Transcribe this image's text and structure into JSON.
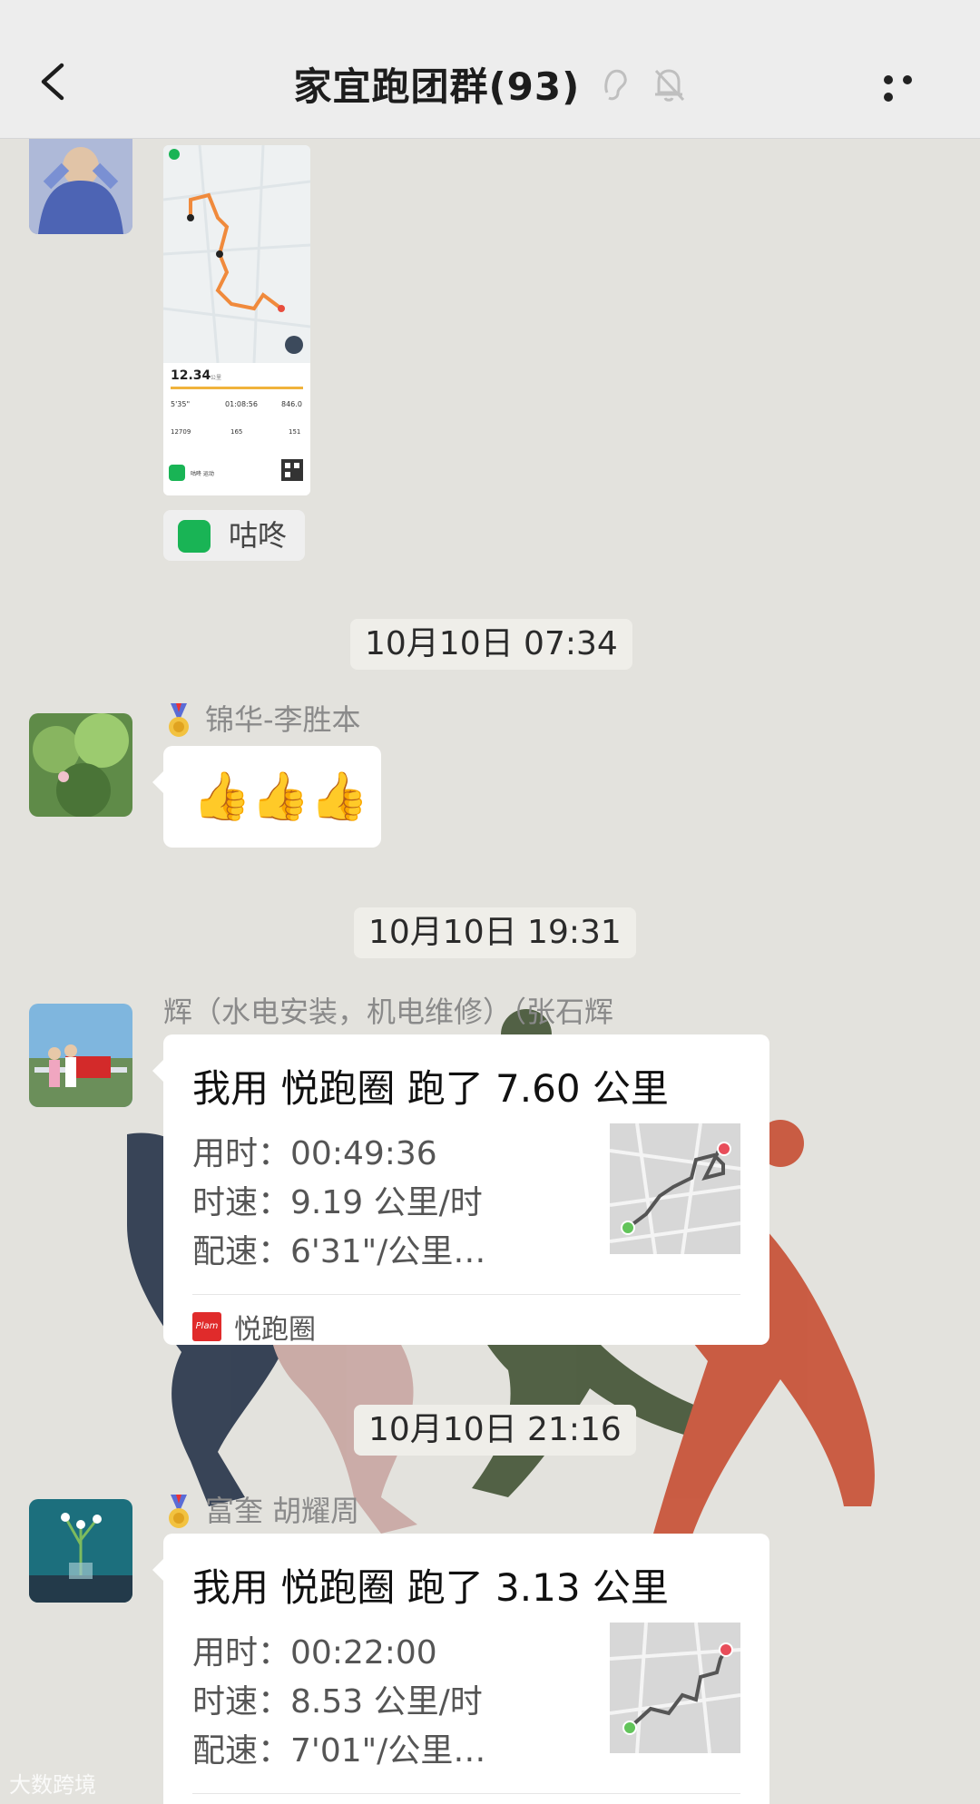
{
  "header": {
    "title": "家宜跑团群(93)",
    "ear_icon": "ear-icon",
    "mute_icon": "bell-off-icon",
    "back_icon": "chevron-left-icon",
    "more_icon": "ellipsis-icon"
  },
  "messages": {
    "first": {
      "app_name": "咕咚",
      "screenshot": {
        "distance": "12.34",
        "distance_unit": "公里",
        "pace": "5'35\"",
        "duration": "01:08:56",
        "calories": "846.0",
        "steps": "12709",
        "heart": "165",
        "cadence": "151",
        "footer": "咕咚 运动"
      }
    },
    "ts1": "10月10日 07:34",
    "msg2": {
      "sender": "锦华-李胜本",
      "content": "👍👍👍"
    },
    "ts2": "10月10日 19:31",
    "msg3": {
      "sender": "辉（水电安装，机电维修）（张石辉",
      "title": "我用 悦跑圈 跑了 7.60 公里",
      "time_label": "用时：",
      "time": "00:49:36",
      "speed_label": "时速：",
      "speed": "9.19 公里/时",
      "pace_label": "配速：",
      "pace": "6'31\"/公里…",
      "source": "悦跑圈",
      "source_logo": "Plam"
    },
    "ts3": "10月10日 21:16",
    "msg4": {
      "sender": "富奎  胡耀周",
      "title": "我用 悦跑圈 跑了 3.13 公里",
      "time_label": "用时：",
      "time": "00:22:00",
      "speed_label": "时速：",
      "speed": "8.53 公里/时",
      "pace_label": "配速：",
      "pace": "7'01\"/公里…"
    }
  },
  "watermark": "大数跨境",
  "colors": {
    "background": "#e3e2dd",
    "runner_navy": "#2e3b4f",
    "runner_pink": "#c9a9a4",
    "runner_green": "#4a5a3c",
    "runner_orange": "#c8553b"
  }
}
